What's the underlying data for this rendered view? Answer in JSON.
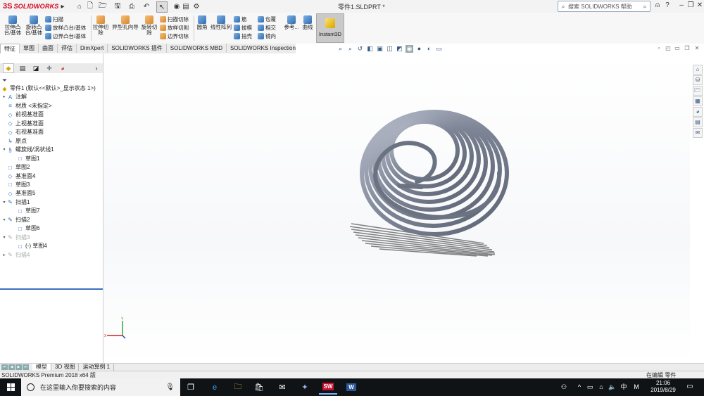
{
  "app": {
    "logo_mark": "3S",
    "logo_text": "SOLIDWORKS",
    "doc_title": "零件1.SLDPRT *",
    "help_search_placeholder": "搜索 SOLIDWORKS 帮助"
  },
  "ribbon": {
    "extrude_boss": "拉伸凸台/基体",
    "revolve_boss": "旋转凸台/基体",
    "sweep_boss": "扫描",
    "loft_boss": "放样凸台/基体",
    "boundary_boss": "边界凸台/基体",
    "extrude_cut": "拉伸切除",
    "hole_wizard": "异型孔向导",
    "revolve_cut": "旋转切除",
    "swept_cut": "扫描切除",
    "lofted_cut": "放样切割",
    "boundary_cut": "边界切除",
    "fillet": "圆角",
    "linear_pattern": "线性阵列",
    "rib": "筋",
    "draft": "拔模",
    "shell": "抽壳",
    "wrap": "包覆",
    "intersect": "相交",
    "mirror": "镜向",
    "reference": "参考...",
    "curves": "曲线",
    "instant3d": "Instant3D"
  },
  "tabs": [
    "特征",
    "草图",
    "曲面",
    "评估",
    "DimXpert",
    "SOLIDWORKS 插件",
    "SOLIDWORKS MBD",
    "SOLIDWORKS Inspection"
  ],
  "tree": {
    "root": "零件1  (默认<<默认>_显示状态 1>)",
    "items": [
      {
        "label": "注解",
        "level": 1,
        "exp": "▸",
        "icon": "A"
      },
      {
        "label": "材质 <未指定>",
        "level": 1,
        "exp": "",
        "icon": "≡"
      },
      {
        "label": "前视基准面",
        "level": 1,
        "exp": "",
        "icon": "◇"
      },
      {
        "label": "上视基准面",
        "level": 1,
        "exp": "",
        "icon": "◇"
      },
      {
        "label": "右视基准面",
        "level": 1,
        "exp": "",
        "icon": "◇"
      },
      {
        "label": "原点",
        "level": 1,
        "exp": "",
        "icon": "↳"
      },
      {
        "label": "螺旋线/涡状线1",
        "level": 1,
        "exp": "▾",
        "icon": "§"
      },
      {
        "label": "草图1",
        "level": 2,
        "exp": "",
        "icon": "□"
      },
      {
        "label": "草图2",
        "level": 1,
        "exp": "",
        "icon": "□"
      },
      {
        "label": "基准面4",
        "level": 1,
        "exp": "",
        "icon": "◇"
      },
      {
        "label": "草图3",
        "level": 1,
        "exp": "",
        "icon": "□"
      },
      {
        "label": "基准面5",
        "level": 1,
        "exp": "",
        "icon": "◇"
      },
      {
        "label": "扫描1",
        "level": 1,
        "exp": "▾",
        "icon": "✎"
      },
      {
        "label": "草图7",
        "level": 2,
        "exp": "",
        "icon": "□"
      },
      {
        "label": "扫描2",
        "level": 1,
        "exp": "▾",
        "icon": "✎"
      },
      {
        "label": "草图6",
        "level": 2,
        "exp": "",
        "icon": "□"
      },
      {
        "label": "扫描3",
        "level": 1,
        "exp": "▾",
        "icon": "✎",
        "dim": true
      },
      {
        "label": "(-) 草图4",
        "level": 2,
        "exp": "",
        "icon": "□"
      },
      {
        "label": "扫描4",
        "level": 1,
        "exp": "▸",
        "icon": "✎",
        "dim": true
      }
    ]
  },
  "model_tabs": [
    "模型",
    "3D 视图",
    "运动算例 1"
  ],
  "status": {
    "product": "SOLIDWORKS Premium 2018 x64 版",
    "units": "在编辑 零件"
  },
  "taskbar": {
    "search_placeholder": "在这里输入你要搜索的内容",
    "ime": "中",
    "ime_mode": "M",
    "time": "21:06",
    "date": "2019/8/29"
  },
  "colors": {
    "accent": "#3a6fc4",
    "brand": "#d6001c",
    "spring": "#7e8596"
  }
}
